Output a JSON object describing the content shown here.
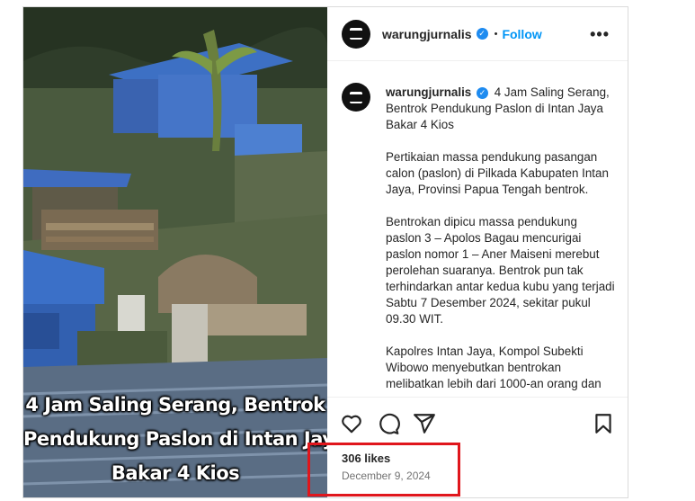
{
  "post": {
    "author": {
      "username": "warungjurnalis",
      "verified": true
    },
    "follow_label": "Follow",
    "separator": "•",
    "more_label": "•••",
    "image_overlay": {
      "line1": "4 Jam Saling Serang, Bentrok",
      "line2": "Pendukung Paslon di Intan Jaya",
      "line3": "Bakar 4 Kios"
    },
    "caption": {
      "username": "warungjurnalis",
      "headline": "4 Jam Saling Serang, Bentrok Pendukung Paslon di Intan Jaya Bakar 4 Kios",
      "para1": "Pertikaian massa pendukung pasangan calon (paslon) di Pilkada Kabupaten Intan Jaya, Provinsi Papua Tengah bentrok.",
      "para2": "Bentrokan dipicu massa pendukung paslon 3 – Apolos Bagau mencurigai paslon nomor 1 – Aner Maiseni merebut perolehan suaranya. Bentrok pun tak terhindarkan antar kedua kubu yang terjadi Sabtu 7 Desember 2024, sekitar pukul 09.30 WIT.",
      "para3": "Kapolres Intan Jaya, Kompol Subekti Wibowo menyebutkan bentrokan melibatkan lebih dari 1000-an orang dan"
    },
    "likes": "306 likes",
    "date": "December 9, 2024",
    "icons": [
      "heart-icon",
      "comment-icon",
      "share-icon",
      "bookmark-icon"
    ],
    "colors": {
      "follow": "#0095f6",
      "verified": "#1e8bf0",
      "highlight": "#e0161c"
    }
  }
}
